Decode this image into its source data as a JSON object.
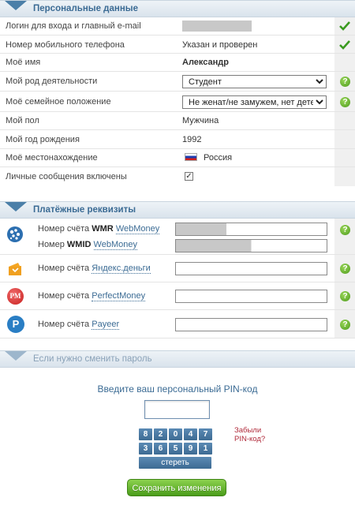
{
  "personal": {
    "title": "Персональные данные",
    "login_label": "Логин для входа и главный e-mail",
    "phone_label": "Номер мобильного телефона",
    "phone_value": "Указан и проверен",
    "name_label": "Моё имя",
    "name_value": "Александр",
    "occupation_label": "Мой род деятельности",
    "occupation_value": "Студент",
    "family_label": "Моё семейное положение",
    "family_value": "Не женат/не замужем, нет детей",
    "gender_label": "Мой пол",
    "gender_value": "Мужчина",
    "birthyear_label": "Мой год рождения",
    "birthyear_value": "1992",
    "location_label": "Моё местонахождение",
    "location_value": "Россия",
    "messages_label": "Личные сообщения включены",
    "messages_checked": "✓"
  },
  "payment": {
    "title": "Платёжные реквизиты",
    "wm_prefix": "Номер счёта",
    "wm_bold": "WMR",
    "wm_link": "WebMoney",
    "wmid_prefix": "Номер",
    "wmid_bold": "WMID",
    "wmid_link": "WebMoney",
    "yandex_prefix": "Номер счёта",
    "yandex_link": "Яндекс.деньги",
    "pm_prefix": "Номер счёта",
    "pm_link": "PerfectMoney",
    "pm_icon_text": "PM",
    "payeer_prefix": "Номер счёта",
    "payeer_link": "Payeer",
    "payeer_icon_text": "P"
  },
  "password": {
    "title": "Если нужно сменить пароль"
  },
  "pin": {
    "prompt": "Введите ваш персональный PIN-код",
    "keys_row1": [
      "8",
      "2",
      "0",
      "4",
      "7"
    ],
    "keys_row2": [
      "3",
      "6",
      "5",
      "9",
      "1"
    ],
    "clear_label": "стереть",
    "forgot_line1": "Забыли",
    "forgot_line2": "PIN-код?"
  },
  "actions": {
    "save_label": "Сохранить изменения",
    "help_glyph": "?"
  },
  "colors": {
    "accent": "#3b6b94",
    "check": "#3a9a1f",
    "help": "#4d9a1c",
    "forgot": "#b02a3a"
  }
}
